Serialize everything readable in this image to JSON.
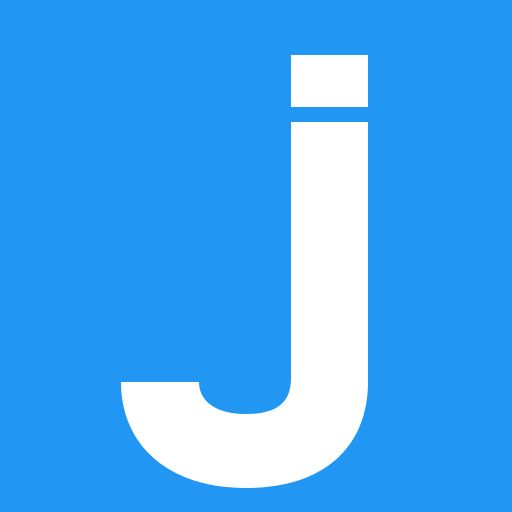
{
  "logo": {
    "letter": "j",
    "background_color": "#2196F3",
    "glyph_color": "#FFFFFF"
  }
}
